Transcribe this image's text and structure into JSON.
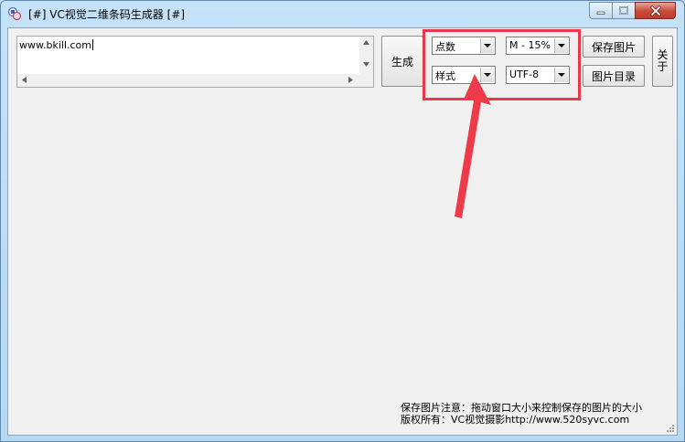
{
  "window": {
    "title": "[#] VC视觉二维条码生成器 [#]"
  },
  "input": {
    "value": "www.bkill.com"
  },
  "buttons": {
    "generate": "生成",
    "save_image": "保存图片",
    "image_dir": "图片目录",
    "about_chars": [
      "关",
      "于"
    ]
  },
  "combos": {
    "dots": "点数",
    "error_correction": "M - 15%",
    "style": "样式",
    "encoding": "UTF-8"
  },
  "footer": {
    "note": "保存图片注意：拖动窗口大小来控制保存的图片的大小",
    "copyright": "版权所有：VC视觉摄影http://www.520syvc.com"
  },
  "colors": {
    "annotation": "#e8384a"
  },
  "icons": {
    "app": "qr-app-icon",
    "minimize": "minimize-icon",
    "maximize": "maximize-icon",
    "close": "close-icon"
  }
}
